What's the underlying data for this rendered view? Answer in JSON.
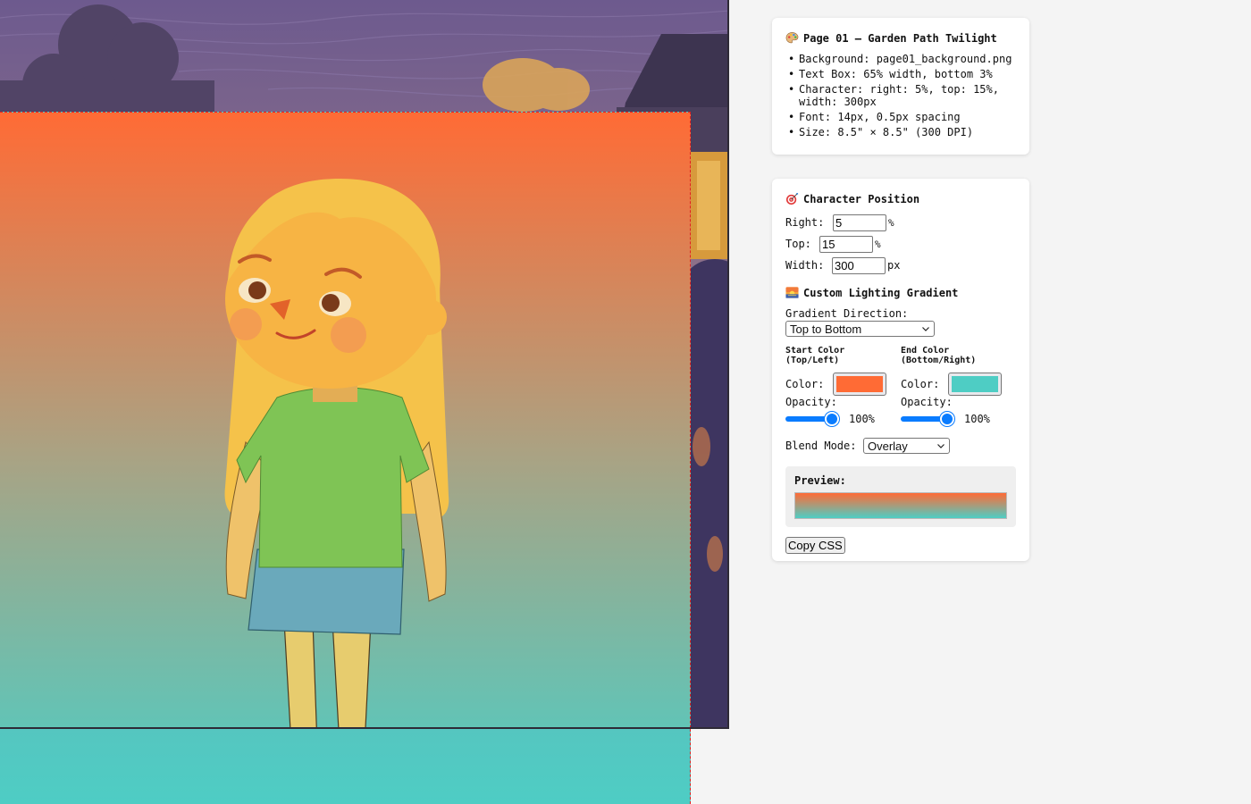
{
  "info": {
    "title": "Page 01 – Garden Path Twilight",
    "specs": [
      "Background: page01_background.png",
      "Text Box: 65% width, bottom 3%",
      "Character: right: 5%, top: 15%, width: 300px",
      "Font: 14px, 0.5px spacing",
      "Size: 8.5\" × 8.5\" (300 DPI)"
    ],
    "icon": "palette-icon"
  },
  "position": {
    "title": "Character Position",
    "icon": "target-icon",
    "right_label": "Right:",
    "right_value": "5",
    "right_unit": "%",
    "top_label": "Top:",
    "top_value": "15",
    "top_unit": "%",
    "width_label": "Width:",
    "width_value": "300",
    "width_unit": "px"
  },
  "lighting": {
    "title": "Custom Lighting Gradient",
    "icon": "sunset-icon",
    "direction_label": "Gradient Direction:",
    "direction_value": "Top to Bottom",
    "start_title": "Start Color (Top/Left)",
    "end_title": "End Color (Bottom/Right)",
    "color_label": "Color:",
    "opacity_label": "Opacity:",
    "start_color": "#ff6b35",
    "end_color": "#4ecdc4",
    "start_opacity": "100%",
    "end_opacity": "100%",
    "start_opacity_value": 1.0,
    "end_opacity_value": 1.0,
    "blend_label": "Blend Mode:",
    "blend_value": "Overlay",
    "preview_label": "Preview:",
    "copy_label": "Copy CSS"
  }
}
